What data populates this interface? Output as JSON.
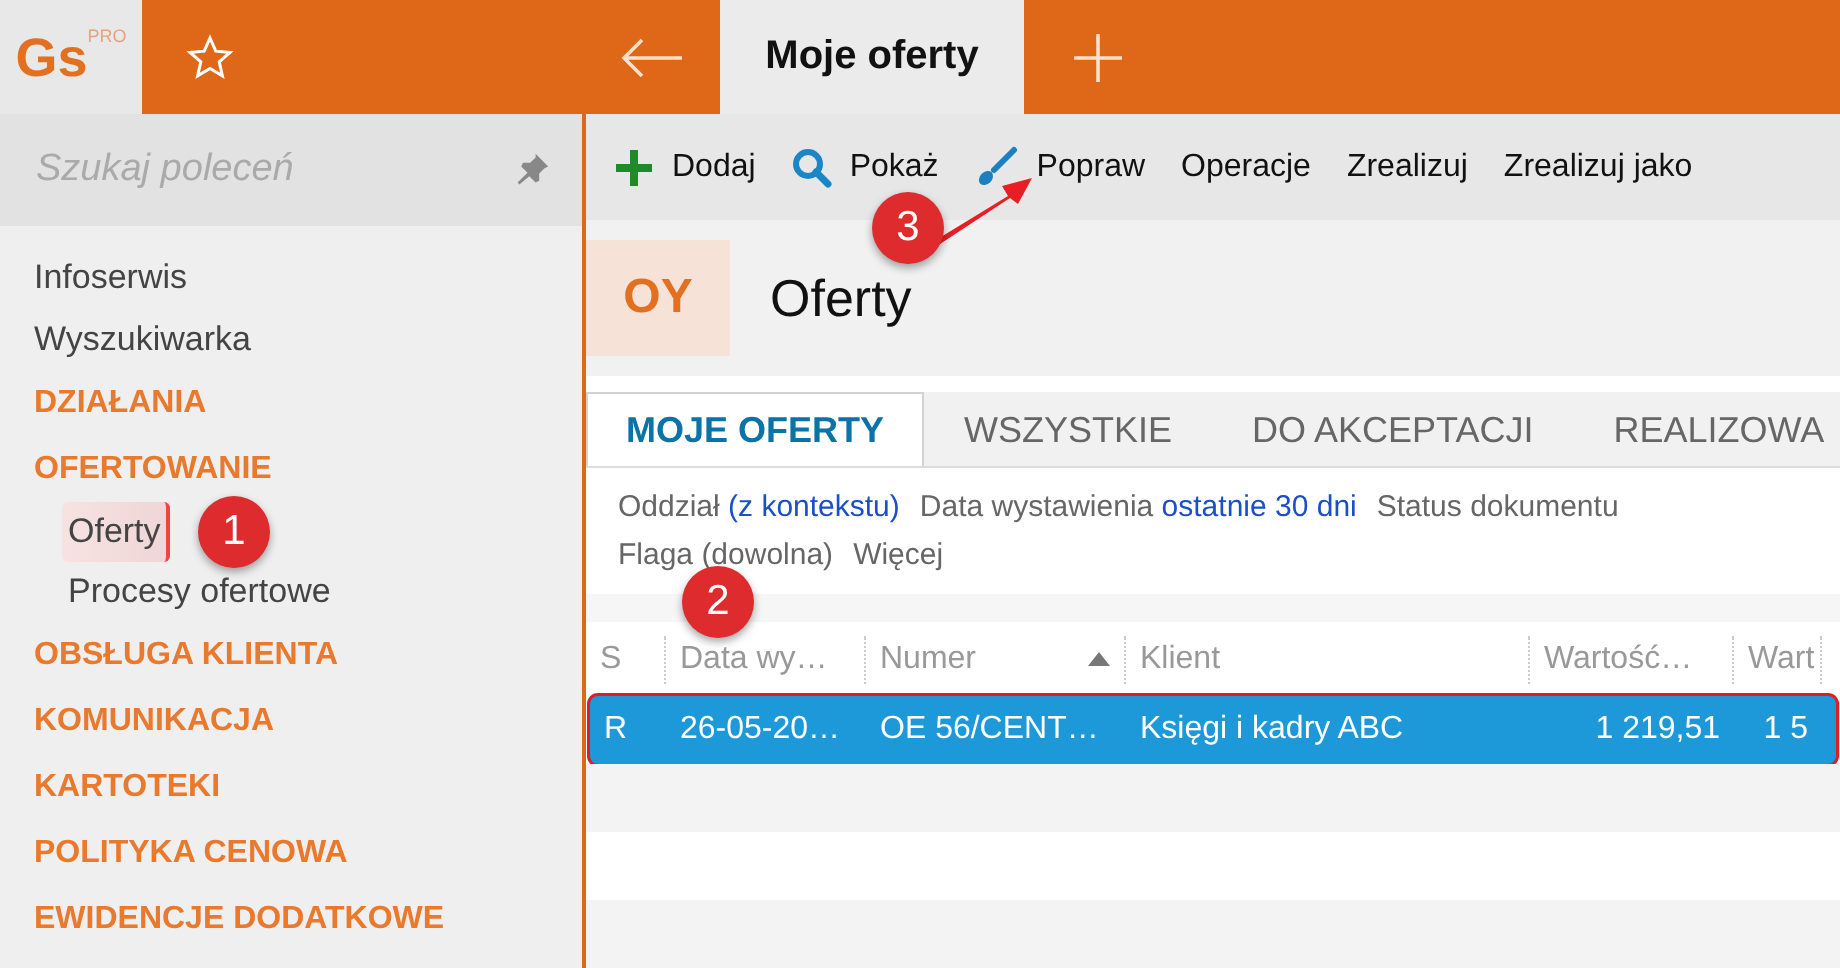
{
  "top_bar": {
    "logo": "Gs",
    "logo_badge": "PRO",
    "tabs": [
      {
        "label": "Moje oferty",
        "selected": true
      }
    ]
  },
  "sidebar": {
    "search": {
      "placeholder": "Szukaj poleceń"
    },
    "items": [
      {
        "label": "Infoserwis",
        "kind": "link"
      },
      {
        "label": "Wyszukiwarka",
        "kind": "link"
      },
      {
        "label": "DZIAŁANIA",
        "kind": "section"
      },
      {
        "label": "OFERTOWANIE",
        "kind": "section",
        "children": [
          {
            "label": "Oferty",
            "selected": true
          },
          {
            "label": "Procesy ofertowe",
            "selected": false
          }
        ]
      },
      {
        "label": "OBSŁUGA KLIENTA",
        "kind": "section"
      },
      {
        "label": "KOMUNIKACJA",
        "kind": "section"
      },
      {
        "label": "KARTOTEKI",
        "kind": "section"
      },
      {
        "label": "POLITYKA CENOWA",
        "kind": "section"
      },
      {
        "label": "EWIDENCJE DODATKOWE",
        "kind": "section"
      }
    ]
  },
  "toolbar": [
    {
      "label": "Dodaj"
    },
    {
      "label": "Pokaż"
    },
    {
      "label": "Popraw"
    },
    {
      "label": "Operacje"
    },
    {
      "label": "Zrealizuj"
    },
    {
      "label": "Zrealizuj jako"
    }
  ],
  "header": {
    "code": "OY",
    "title": "Oferty"
  },
  "tabs": [
    {
      "label": "MOJE OFERTY",
      "selected": true
    },
    {
      "label": "WSZYSTKIE",
      "selected": false
    },
    {
      "label": "DO AKCEPTACJI",
      "selected": false
    },
    {
      "label": "REALIZOWA",
      "selected": false
    }
  ],
  "filters": [
    [
      {
        "label": "Oddział",
        "value": "(z kontekstu)"
      },
      {
        "label": "Data wystawienia",
        "value": "ostatnie 30 dni"
      },
      {
        "label": "Status dokumentu"
      }
    ],
    [
      {
        "label": "Flaga (dowolna)"
      },
      {
        "label": "Więcej"
      }
    ]
  ],
  "table": {
    "columns": [
      {
        "label": "S",
        "sorted": false
      },
      {
        "label": "Data wy…",
        "sorted": false
      },
      {
        "label": "Numer",
        "sorted": true
      },
      {
        "label": "Klient",
        "sorted": false
      },
      {
        "label": "Wartość…",
        "sorted": false
      },
      {
        "label": "Wart",
        "sorted": false
      }
    ],
    "rows": [
      {
        "cells": [
          "R",
          "26-05-20…",
          "OE 56/CENT…",
          "Księgi i kadry ABC",
          "1 219,51",
          "1 5"
        ],
        "selected": true
      }
    ]
  },
  "callouts": [
    {
      "label": "1"
    },
    {
      "label": "2"
    },
    {
      "label": "3"
    }
  ]
}
